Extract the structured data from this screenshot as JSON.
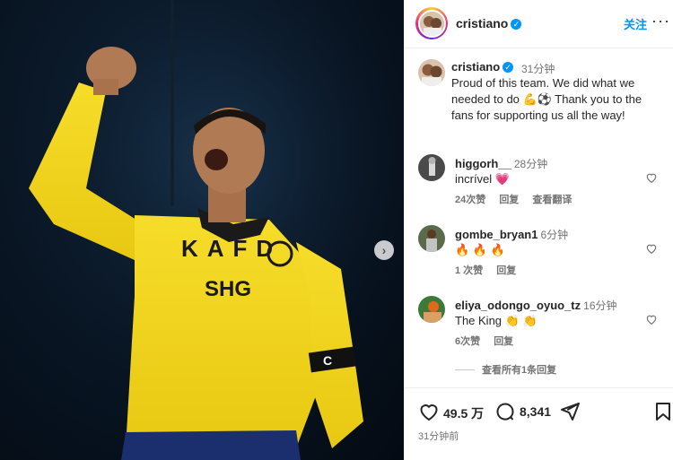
{
  "post": {
    "username": "cristiano",
    "follow_label": "关注",
    "more_label": "···",
    "caption_username": "cristiano",
    "caption_time": "31分钟",
    "caption_text": "Proud of this team. We did what we needed to do 💪⚽ Thank you to the fans for supporting us all the way!",
    "kit_sponsor": "KAFD",
    "kit_sponsor_2": "SHG",
    "armband": "C"
  },
  "comments": [
    {
      "username": "higgorh__",
      "time": "28分钟",
      "text": "incrível 💗",
      "likes": "24次赞",
      "reply": "回复",
      "translate": "查看翻译"
    },
    {
      "username": "gombe_bryan1",
      "time": "6分钟",
      "text": "🔥 🔥 🔥",
      "likes": "1 次赞",
      "reply": "回复"
    },
    {
      "username": "eliya_odongo_oyuo_tz",
      "time": "16分钟",
      "text": "The King 👏 👏",
      "likes": "6次赞",
      "reply": "回复"
    }
  ],
  "view_replies": "查看所有1条回复",
  "actions": {
    "likes_count": "49.5 万",
    "comments_count": "8,341",
    "posted_time": "31分钟前"
  },
  "colors": {
    "link": "#0095f6",
    "like_heart": "#ed4956",
    "jersey": "#f2d51c"
  }
}
